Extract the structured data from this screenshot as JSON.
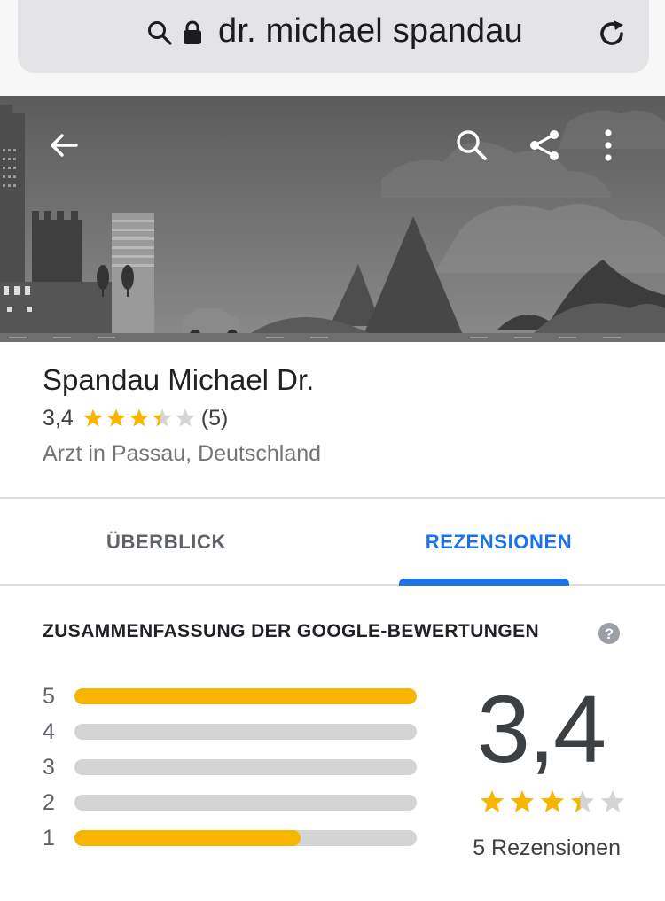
{
  "browser": {
    "url_text": "dr. michael spandau",
    "icons": [
      "search-icon",
      "lock-icon",
      "reload-icon"
    ]
  },
  "hero": {
    "icons": [
      "back-arrow-icon",
      "search-icon",
      "share-icon",
      "more-vert-icon"
    ]
  },
  "place": {
    "name": "Spandau Michael Dr.",
    "rating": "3,4",
    "rating_value": 3.4,
    "rating_max": 5,
    "review_count_short": "(5)",
    "category": "Arzt in Passau, Deutschland"
  },
  "tabs": [
    {
      "label": "ÜBERBLICK",
      "active": false
    },
    {
      "label": "REZENSIONEN",
      "active": true
    }
  ],
  "summary": {
    "title": "ZUSAMMENFASSUNG DER GOOGLE-BEWERTUNGEN",
    "help_icon": "help-icon",
    "distribution": [
      {
        "label": "5",
        "fraction": 1.0
      },
      {
        "label": "4",
        "fraction": 0.0
      },
      {
        "label": "3",
        "fraction": 0.0
      },
      {
        "label": "2",
        "fraction": 0.0
      },
      {
        "label": "1",
        "fraction": 0.66
      }
    ],
    "score": "3,4",
    "reviews_label": "5 Rezensionen"
  },
  "colors": {
    "accent": "#1a73e8",
    "star": "#f7b500",
    "star_empty": "#d4d4d4",
    "bar_fill": "#f7b500",
    "bar_track": "#d4d4d4"
  }
}
